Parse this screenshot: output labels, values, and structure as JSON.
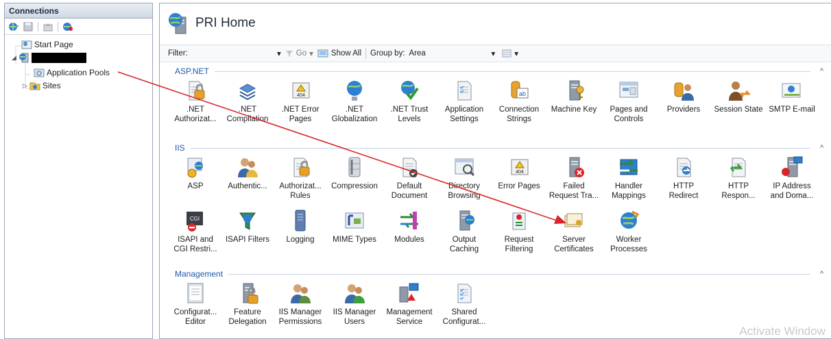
{
  "connections": {
    "header": "Connections",
    "tree": {
      "start_page": "Start Page",
      "app_pools": "Application Pools",
      "sites": "Sites"
    }
  },
  "main": {
    "title": "PRI Home",
    "filter": {
      "label": "Filter:",
      "go": "Go",
      "show_all": "Show All",
      "group_by_label": "Group by:",
      "group_by_value": "Area"
    },
    "sections": {
      "aspnet": "ASP.NET",
      "iis": "IIS",
      "management": "Management"
    },
    "aspnet_items": [
      {
        "l1": ".NET",
        "l2": "Authorizat..."
      },
      {
        "l1": ".NET",
        "l2": "Compilation"
      },
      {
        "l1": ".NET Error",
        "l2": "Pages"
      },
      {
        "l1": ".NET",
        "l2": "Globalization"
      },
      {
        "l1": ".NET Trust",
        "l2": "Levels"
      },
      {
        "l1": "Application",
        "l2": "Settings"
      },
      {
        "l1": "Connection",
        "l2": "Strings"
      },
      {
        "l1": "Machine Key",
        "l2": ""
      },
      {
        "l1": "Pages and",
        "l2": "Controls"
      },
      {
        "l1": "Providers",
        "l2": ""
      },
      {
        "l1": "Session State",
        "l2": ""
      },
      {
        "l1": "SMTP E-mail",
        "l2": ""
      }
    ],
    "iis_items": [
      {
        "l1": "ASP",
        "l2": ""
      },
      {
        "l1": "Authentic...",
        "l2": ""
      },
      {
        "l1": "Authorizat...",
        "l2": "Rules"
      },
      {
        "l1": "Compression",
        "l2": ""
      },
      {
        "l1": "Default",
        "l2": "Document"
      },
      {
        "l1": "Directory",
        "l2": "Browsing"
      },
      {
        "l1": "Error Pages",
        "l2": ""
      },
      {
        "l1": "Failed",
        "l2": "Request Tra..."
      },
      {
        "l1": "Handler",
        "l2": "Mappings"
      },
      {
        "l1": "HTTP",
        "l2": "Redirect"
      },
      {
        "l1": "HTTP",
        "l2": "Respon..."
      },
      {
        "l1": "IP Address",
        "l2": "and Doma..."
      },
      {
        "l1": "ISAPI and",
        "l2": "CGI Restri..."
      },
      {
        "l1": "ISAPI Filters",
        "l2": ""
      },
      {
        "l1": "Logging",
        "l2": ""
      },
      {
        "l1": "MIME Types",
        "l2": ""
      },
      {
        "l1": "Modules",
        "l2": ""
      },
      {
        "l1": "Output",
        "l2": "Caching"
      },
      {
        "l1": "Request",
        "l2": "Filtering"
      },
      {
        "l1": "Server",
        "l2": "Certificates"
      },
      {
        "l1": "Worker",
        "l2": "Processes"
      }
    ],
    "mgmt_items": [
      {
        "l1": "Configurat...",
        "l2": "Editor"
      },
      {
        "l1": "Feature",
        "l2": "Delegation"
      },
      {
        "l1": "IIS Manager",
        "l2": "Permissions"
      },
      {
        "l1": "IIS Manager",
        "l2": "Users"
      },
      {
        "l1": "Management",
        "l2": "Service"
      },
      {
        "l1": "Shared",
        "l2": "Configurat..."
      }
    ]
  },
  "watermark": "Activate Window",
  "colors": {
    "arrow": "#d9252a",
    "section_text": "#1f5ba8"
  }
}
